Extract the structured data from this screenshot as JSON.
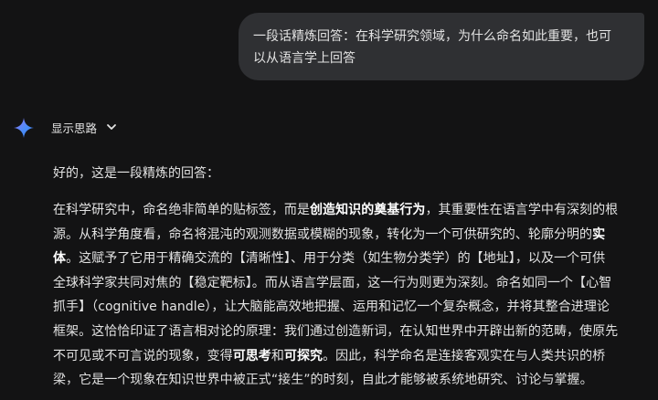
{
  "user_message": {
    "line1": "一段话精炼回答：在科学研究领域，为什么命名如此重要，也可",
    "line2": "以从语言学上回答"
  },
  "assistant": {
    "icon": "gemini-sparkle-icon",
    "thinking_toggle_label": "显示思路",
    "intro": "好的，这是一段精炼的回答：",
    "lines": [
      [
        {
          "t": "在科学研究中，命名绝非简单的贴标签，而是"
        },
        {
          "t": "创造知识的奠基行为",
          "b": true
        },
        {
          "t": "，其重要性在语言学中有深刻的根"
        }
      ],
      [
        {
          "t": "源。从科学角度看，命名将混沌的观测数据或模糊的现象，转化为一个可供研究的、轮廓分明的"
        },
        {
          "t": "实",
          "b": true
        }
      ],
      [
        {
          "t": "体",
          "b": true
        },
        {
          "t": "。这赋予了它用于精确交流的【清晰性】、用于分类（如生物分类学）的【地址】，以及一个可供"
        }
      ],
      [
        {
          "t": "全球科学家共同对焦的【稳定靶标】。而从语言学层面，这一行为则更为深刻。命名如同一个【心智"
        }
      ],
      [
        {
          "t": "抓手】（cognitive handle），让大脑能高效地把握、运用和记忆一个复杂概念，并将其整合进理论"
        }
      ],
      [
        {
          "t": "框架。这恰恰印证了语言相对论的原理：我们通过创造新词，在认知世界中开辟出新的范畴，使原先"
        }
      ],
      [
        {
          "t": "不可见或不可言说的现象，变得"
        },
        {
          "t": "可思考",
          "b": true
        },
        {
          "t": "和"
        },
        {
          "t": "可探究",
          "b": true
        },
        {
          "t": "。因此，科学命名是连接客观实在与人类共识的桥"
        }
      ],
      [
        {
          "t": "梁，它是一个现象在知识世界中被正式“接生”的时刻，自此才能够被系统地研究、讨论与掌握。"
        }
      ]
    ]
  },
  "colors": {
    "background": "#131314",
    "user_bubble": "#2f3033",
    "text": "#e3e3e3"
  }
}
